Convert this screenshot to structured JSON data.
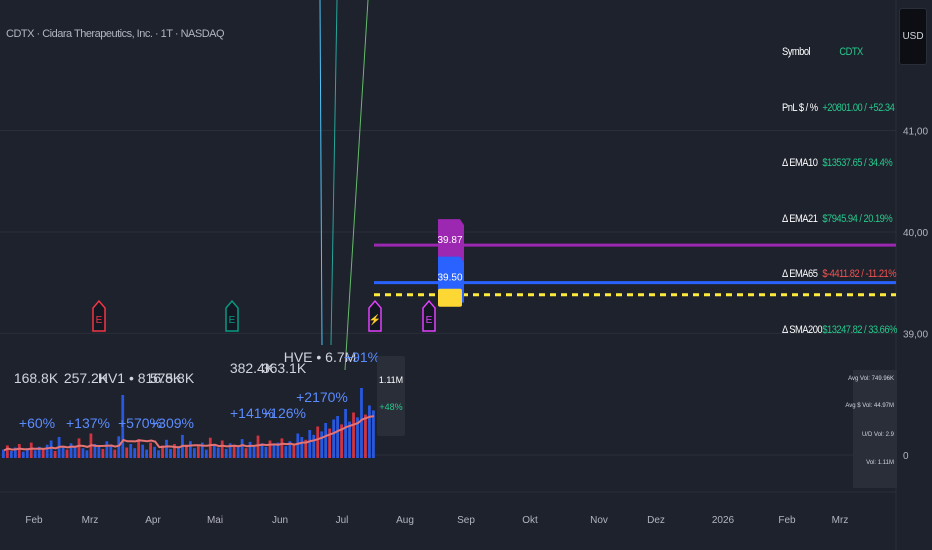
{
  "header": {
    "title": "CDTX · Cidara Therapeutics, Inc. · 1T · NASDAQ",
    "currency": "USD"
  },
  "price_axis": {
    "ticks": [
      {
        "label": "41,00",
        "value": 41.0
      },
      {
        "label": "40,00",
        "value": 40.0
      },
      {
        "label": "39,00",
        "value": 39.0
      },
      {
        "label": "0",
        "value": 37.8
      }
    ]
  },
  "time_axis": {
    "labels": [
      "Feb",
      "Mrz",
      "Apr",
      "Mai",
      "Jun",
      "Jul",
      "Aug",
      "Sep",
      "Okt",
      "Nov",
      "Dez",
      "2026",
      "Feb",
      "Mrz"
    ]
  },
  "info_table": [
    {
      "key": "Symbol",
      "value": "CDTX"
    },
    {
      "key": "PnL $ / %",
      "value": "+20801.00 / +52.34"
    },
    {
      "key": "Δ EMA10",
      "value": "$13537.65 / 34.4%"
    },
    {
      "key": "Δ EMA21",
      "value": "$7945.94 / 20.19%"
    },
    {
      "key": "Δ EMA65",
      "value": "$-4411.82 / -11.21%"
    },
    {
      "key": "Δ SMA200",
      "value": "$13247.82 / 33.66%"
    }
  ],
  "mini_table": [
    {
      "label": "Avg Vol:",
      "value": "749.96K"
    },
    {
      "label": "Avg $ Vol:",
      "value": "44.97M"
    },
    {
      "label": "U/D Vol:",
      "value": "2.9"
    },
    {
      "label": "Vol:",
      "value": "1.11M"
    }
  ],
  "price_levels": [
    {
      "label": "39.87",
      "value": 39.87,
      "color": "#9c27b0",
      "style": "solid"
    },
    {
      "label": "39.50",
      "value": 39.5,
      "color": "#2962ff",
      "style": "solid"
    },
    {
      "label": "",
      "value": 39.38,
      "color": "#ffeb3b",
      "style": "dashed"
    }
  ],
  "event_markers": [
    {
      "symbol": "E",
      "color": "#f23645"
    },
    {
      "symbol": "E",
      "color": "#089981"
    },
    {
      "symbol": "⚡",
      "color": "#e040fb"
    },
    {
      "symbol": "E",
      "color": "#e040fb"
    }
  ],
  "volume_annotations": [
    {
      "volume": "168.8K",
      "change": "+60%"
    },
    {
      "volume": "257.2K",
      "change": "+137%"
    },
    {
      "volume": "HV1 • 816.8K",
      "change": "+570%"
    },
    {
      "volume": "575.8K",
      "change": "+309%"
    },
    {
      "volume": "382.4K",
      "change": "+141%"
    },
    {
      "volume": "363.1K",
      "change": "+126%"
    },
    {
      "volume": "HVE • 6.7M",
      "change": "+2170%"
    },
    {
      "volume": "",
      "change": "+91%"
    }
  ],
  "last_volume": {
    "value": "1.11M",
    "change": "+48%"
  },
  "colors": {
    "background": "#1e222d",
    "up_volume": "#2962ff",
    "down_volume": "#f23645",
    "volume_ma": "#e57373",
    "positive": "#26c98b"
  },
  "chart_data": {
    "type": "bar",
    "title": "CDTX · Cidara Therapeutics, Inc. · 1T · NASDAQ",
    "series": [
      {
        "name": "Volume",
        "values": [
          0.12,
          0.18,
          0.1,
          0.15,
          0.2,
          0.09,
          0.14,
          0.22,
          0.11,
          0.16,
          0.13,
          0.19,
          0.25,
          0.1,
          0.3,
          0.17,
          0.12,
          0.21,
          0.15,
          0.28,
          0.14,
          0.11,
          0.35,
          0.2,
          0.16,
          0.13,
          0.24,
          0.18,
          0.12,
          0.31,
          0.9,
          0.15,
          0.2,
          0.14,
          0.27,
          0.19,
          0.12,
          0.22,
          0.16,
          0.11,
          0.18,
          0.26,
          0.13,
          0.2,
          0.15,
          0.33,
          0.19,
          0.24,
          0.14,
          0.17,
          0.22,
          0.12,
          0.29,
          0.18,
          0.15,
          0.25,
          0.13,
          0.21,
          0.19,
          0.16,
          0.27,
          0.14,
          0.23,
          0.18,
          0.32,
          0.21,
          0.16,
          0.25,
          0.19,
          0.22,
          0.28,
          0.17,
          0.24,
          0.2,
          0.35,
          0.3,
          0.26,
          0.4,
          0.33,
          0.45,
          0.38,
          0.5,
          0.42,
          0.55,
          0.6,
          0.48,
          0.7,
          0.52,
          0.65,
          0.58,
          1.0,
          0.62,
          0.75,
          0.68
        ]
      }
    ],
    "ylim": [
      37.8,
      41.4
    ],
    "grid": true
  }
}
